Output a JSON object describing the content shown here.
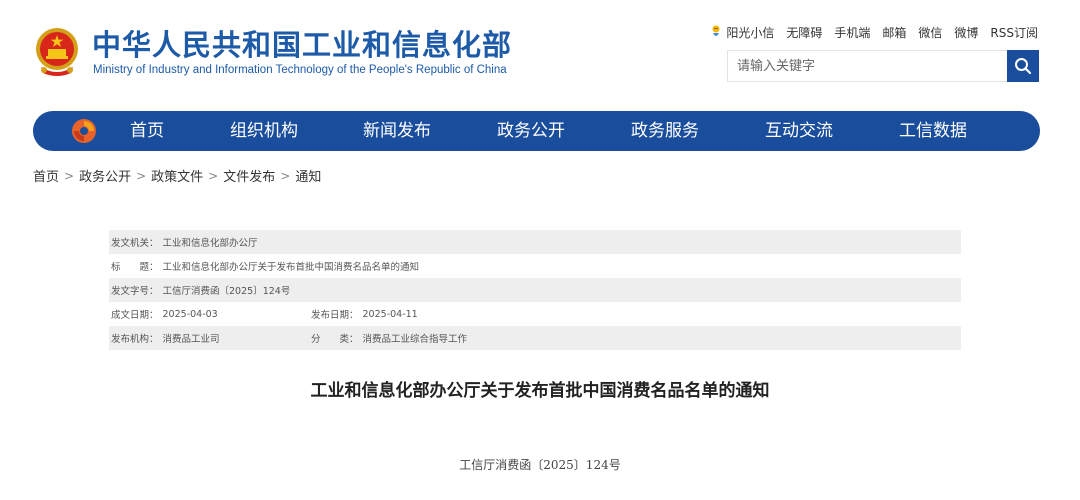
{
  "header": {
    "title": "中华人民共和国工业和信息化部",
    "subtitle": "Ministry of Industry and Information Technology of the People's Republic of China",
    "emblem_icon": "national-emblem-icon",
    "brand_color": "#1d5aa7"
  },
  "top_links": {
    "sunshine": "阳光小信",
    "accessibility": "无障碍",
    "mobile": "手机端",
    "mail": "邮箱",
    "wechat": "微信",
    "weibo": "微博",
    "rss": "RSS订阅"
  },
  "search": {
    "placeholder": "请输入关键字",
    "icon": "search-icon"
  },
  "nav": {
    "color": "#1a4e9c",
    "items": [
      "首页",
      "组织机构",
      "新闻发布",
      "政务公开",
      "政务服务",
      "互动交流",
      "工信数据"
    ]
  },
  "breadcrumb": [
    "首页",
    "政务公开",
    "政策文件",
    "文件发布",
    "通知"
  ],
  "info": {
    "issuer": {
      "label": "发文机关：",
      "value": "工业和信息化部办公厅"
    },
    "title": {
      "label": "标　　题：",
      "value": "工业和信息化部办公厅关于发布首批中国消费名品名单的通知"
    },
    "doc_no": {
      "label": "发文字号：",
      "value": "工信厅消费函〔2025〕124号"
    },
    "created": {
      "label": "成文日期：",
      "value": "2025-04-03"
    },
    "published": {
      "label": "发布日期：",
      "value": "2025-04-11"
    },
    "agency": {
      "label": "发布机构：",
      "value": "消费品工业司"
    },
    "category": {
      "label": "分　　类：",
      "value": "消费品工业综合指导工作"
    }
  },
  "article": {
    "title": "工业和信息化部办公厅关于发布首批中国消费名品名单的通知",
    "doc_number": "工信厅消费函〔2025〕124号"
  }
}
